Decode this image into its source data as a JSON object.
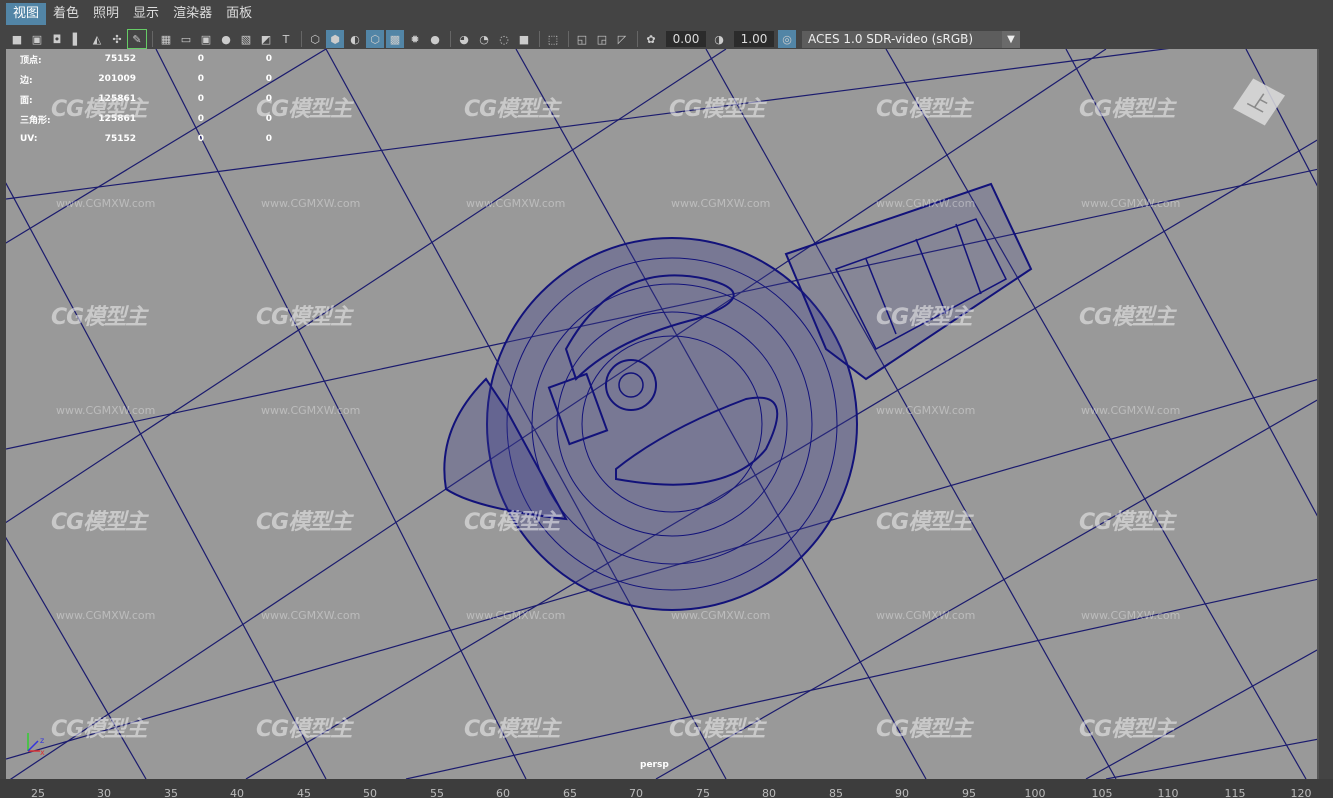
{
  "menu": [
    "视图",
    "着色",
    "照明",
    "显示",
    "渲染器",
    "面板"
  ],
  "toolbar": {
    "icons": [
      "camera-icon",
      "camera-attributes-icon",
      "bookmark-icon",
      "image-plane-icon",
      "grease-pencil-icon",
      "move-camera-icon",
      "grid-icon",
      "film-gate-icon",
      "resolution-gate-icon",
      "gate-mask-icon",
      "field-chart-icon",
      "safe-action-icon",
      "safe-title-icon",
      "wireframe-icon",
      "smooth-shade-icon",
      "textured-icon",
      "wireframe-on-shaded-icon",
      "xray-icon",
      "lights-icon",
      "shadows-icon",
      "screen-space-ao-icon",
      "motion-blur-icon",
      "anti-aliasing-icon",
      "depth-of-field-icon",
      "isolate-select-icon",
      "xray-joints-icon",
      "xray-active-icon",
      "backface-icon",
      "exposure-icon",
      "gamma-icon",
      "color-management-icon"
    ],
    "exposure": "0.00",
    "gamma": "1.00",
    "color_space": "ACES 1.0 SDR-video (sRGB)"
  },
  "hud": [
    {
      "label": "顶点:",
      "v1": "75152",
      "v2": "0",
      "v3": "0"
    },
    {
      "label": "边:",
      "v1": "201009",
      "v2": "0",
      "v3": "0"
    },
    {
      "label": "面:",
      "v1": "125861",
      "v2": "0",
      "v3": "0"
    },
    {
      "label": "三角形:",
      "v1": "125861",
      "v2": "0",
      "v3": "0"
    },
    {
      "label": "UV:",
      "v1": "75152",
      "v2": "0",
      "v3": "0"
    }
  ],
  "camera": "persp",
  "viewcube_face": "上",
  "axis_labels": {
    "x": "x",
    "z": "z"
  },
  "watermark": {
    "logo": "CG模型主",
    "url": "www.CGMXW.com"
  },
  "timeline_ticks": [
    "25",
    "30",
    "35",
    "40",
    "45",
    "50",
    "55",
    "60",
    "65",
    "70",
    "75",
    "80",
    "85",
    "90",
    "95",
    "100",
    "105",
    "110",
    "115",
    "120"
  ],
  "colors": {
    "viewport_bg": "#999999",
    "grid_line": "#1b1b6e",
    "wireframe": "#12127a",
    "highlight": "#5285a6"
  }
}
